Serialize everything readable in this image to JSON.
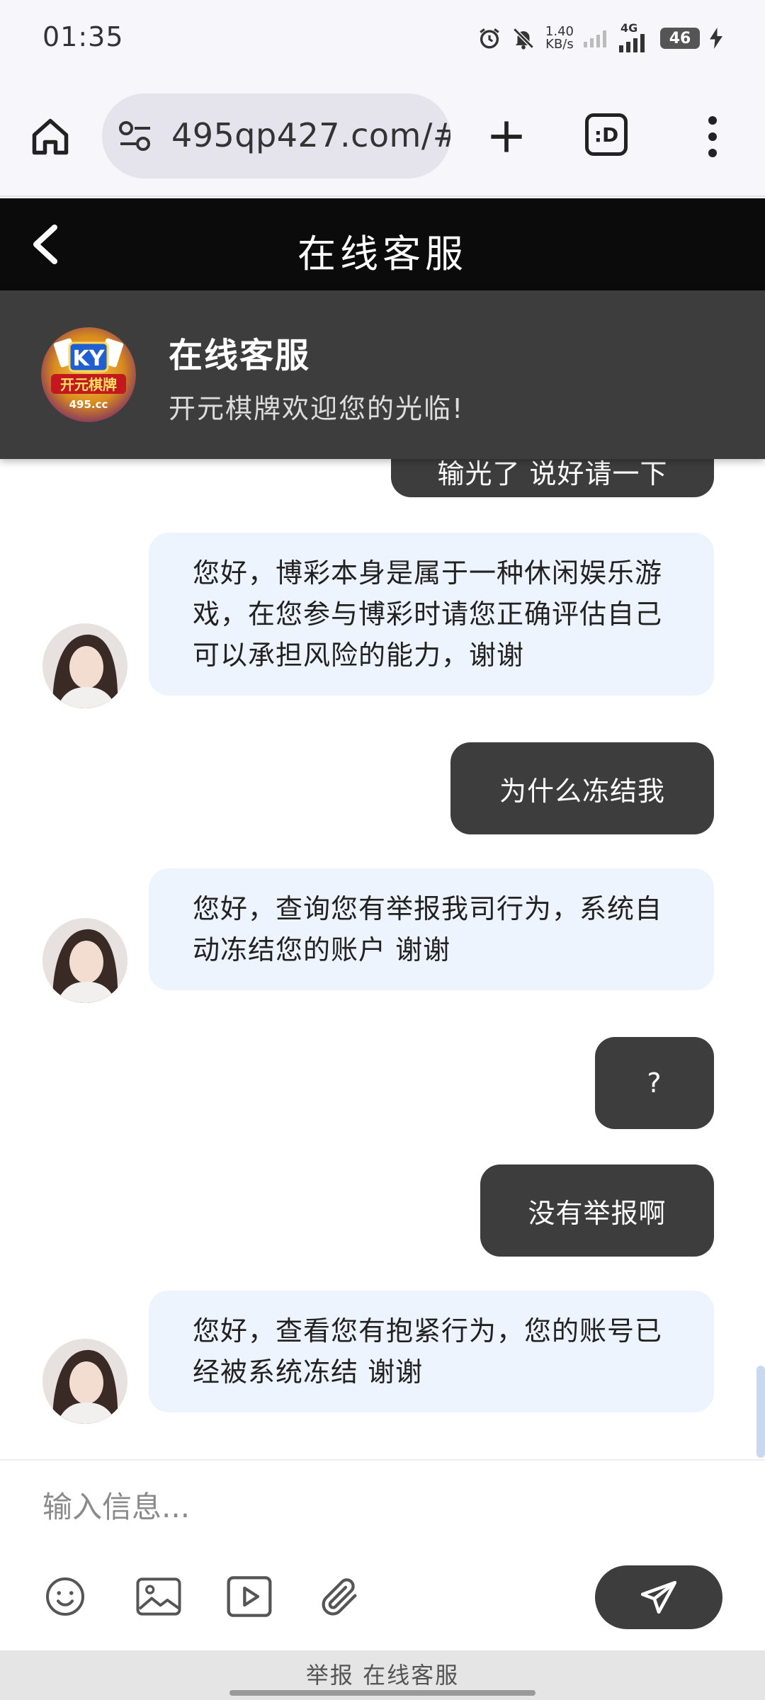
{
  "status_bar": {
    "time": "01:35",
    "net_speed_value": "1.40",
    "net_speed_unit": "KB/s",
    "network_type": "4G",
    "battery": "46"
  },
  "browser": {
    "url": "495qp427.com/#/",
    "tabs_label": ":D"
  },
  "chat_header": {
    "title": "在线客服"
  },
  "service_banner": {
    "logo_text_top": "KY",
    "logo_text_main": "开元棋牌",
    "logo_text_domain": "495.cc",
    "title": "在线客服",
    "subtitle": "开元棋牌欢迎您的光临!"
  },
  "messages": {
    "partial_top": "输光了 说好请一下",
    "items": [
      {
        "from": "agent",
        "text": "您好，博彩本身是属于一种休闲娱乐游戏，在您参与博彩时请您正确评估自己可以承担风险的能力，谢谢"
      },
      {
        "from": "user",
        "text": "为什么冻结我"
      },
      {
        "from": "agent",
        "text": "您好，查询您有举报我司行为，系统自动冻结您的账户 谢谢"
      },
      {
        "from": "user",
        "text": "?"
      },
      {
        "from": "user",
        "text": "没有举报啊"
      },
      {
        "from": "agent",
        "text": "您好，查看您有抱紧行为，您的账号已经被系统冻结 谢谢"
      }
    ]
  },
  "composer": {
    "placeholder": "输入信息...",
    "tools": [
      "emoji-icon",
      "image-icon",
      "video-icon",
      "attachment-icon"
    ],
    "send_icon": "send-icon"
  },
  "footer": {
    "text": "举报 在线客服"
  },
  "colors": {
    "header_bg": "#0b0b0b",
    "banner_bg": "#3d3d3d",
    "user_bubble": "#3d3d3d",
    "agent_bubble": "#eef4fd"
  }
}
